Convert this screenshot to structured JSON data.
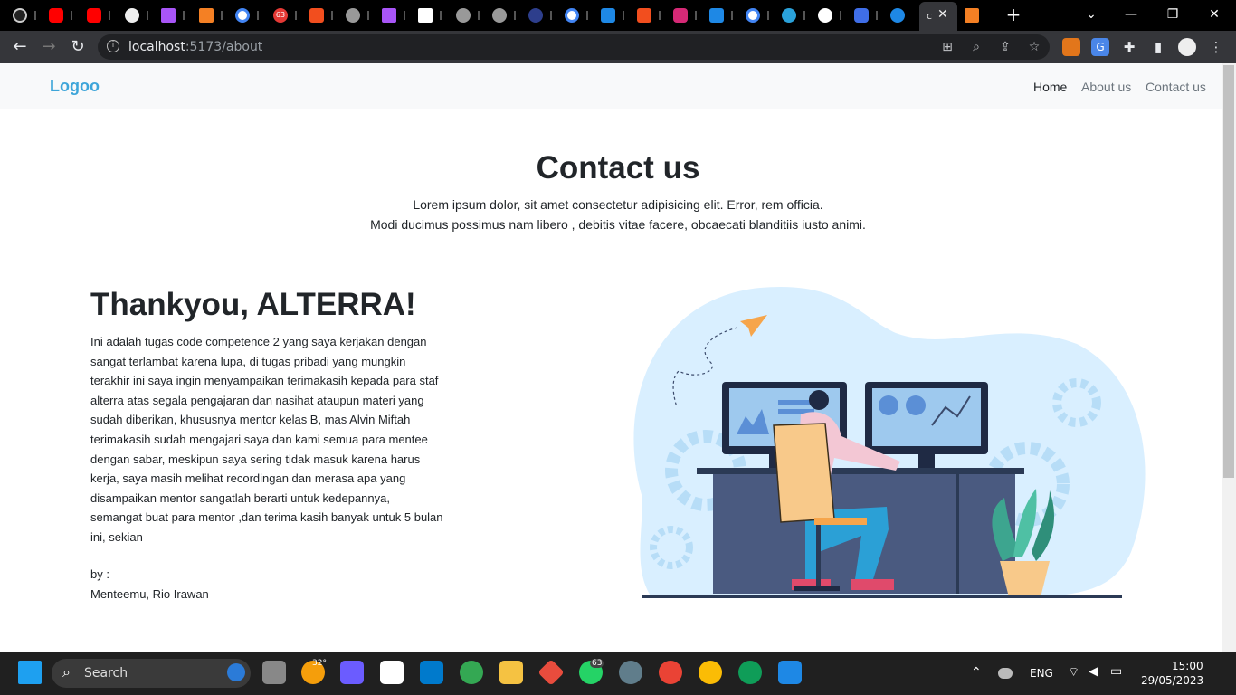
{
  "browser": {
    "url_host": "localhost",
    "url_path": ":5173/about",
    "active_tab_short": "c"
  },
  "navbar": {
    "brand": "Logoo",
    "links": [
      "Home",
      "About us",
      "Contact us"
    ]
  },
  "hero": {
    "title": "Contact us",
    "line1": "Lorem ipsum dolor, sit amet consectetur adipisicing elit. Error, rem officia.",
    "line2": "Modi ducimus possimus nam libero , debitis vitae facere, obcaecati blanditiis iusto animi."
  },
  "content": {
    "heading": "Thankyou, ALTERRA!",
    "paragraph": "Ini adalah tugas code competence 2 yang saya kerjakan dengan sangat terlambat karena lupa, di tugas pribadi yang mungkin terakhir ini saya ingin menyampaikan terimakasih kepada para staf alterra atas segala pengajaran dan nasihat ataupun materi yang sudah diberikan, khususnya mentor kelas B, mas Alvin Miftah terimakasih sudah mengajari saya dan kami semua para mentee dengan sabar, meskipun saya sering tidak masuk karena harus kerja, saya masih melihat recordingan dan merasa apa yang disampaikan mentor sangatlah berarti untuk kedepannya, semangat buat para mentor ,dan terima kasih banyak untuk 5 bulan ini, sekian",
    "by": "by :",
    "author": "Menteemu, Rio Irawan"
  },
  "taskbar": {
    "search_label": "Search",
    "weather": "32°",
    "whatsapp_badge": "63",
    "language": "ENG",
    "time": "15:00",
    "date": "29/05/2023"
  },
  "tabs_badge": "63"
}
